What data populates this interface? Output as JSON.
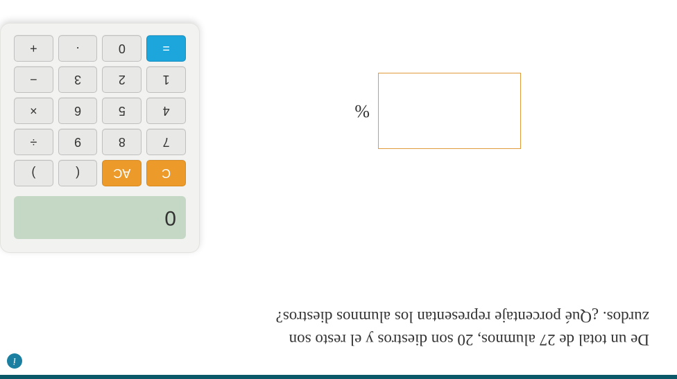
{
  "question": {
    "line1_pre": "De un total de ",
    "num1": "27",
    "line1_mid": " alumnos, ",
    "num2": "20",
    "line1_post": " son diestros y el resto son",
    "line2": "zurdos. ¿Qué porcentaje representan los alumnos diestros?"
  },
  "answer": {
    "value": "",
    "percent": "%"
  },
  "help": {
    "symbol": "i"
  },
  "calculator": {
    "display": "0",
    "buttons": {
      "c": "C",
      "ac": "AC",
      "paren_open": "(",
      "paren_close": ")",
      "b7": "7",
      "b8": "8",
      "b9": "9",
      "div": "÷",
      "b4": "4",
      "b5": "5",
      "b6": "6",
      "mul": "×",
      "b1": "1",
      "b2": "2",
      "b3": "3",
      "sub": "−",
      "b0": "0",
      "dot": "·",
      "add": "+",
      "eq": "="
    }
  }
}
